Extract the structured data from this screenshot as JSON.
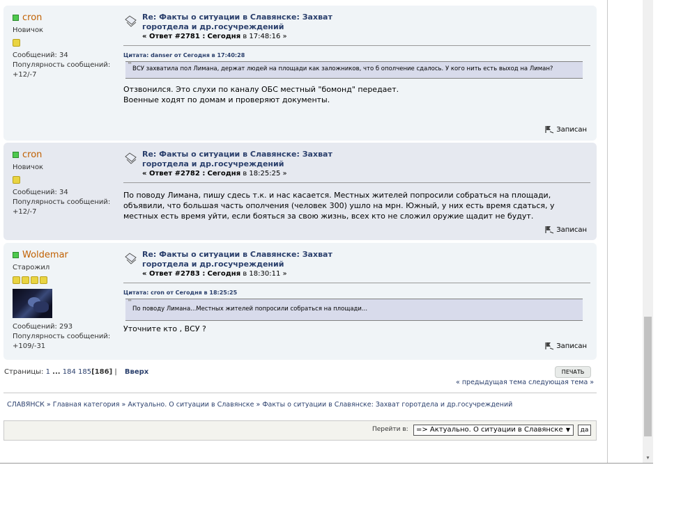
{
  "posts": [
    {
      "poster": {
        "name": "cron",
        "group": "Новичок",
        "stars": 1,
        "messages": "Сообщений: 34",
        "popularity_label": "Популярность сообщений:",
        "popularity_value": "+12/-7"
      },
      "subject_line1": "Re: Факты о ситуации в Славянске: Захват",
      "subject_line2": "горотдела и др.госучреждений",
      "reply_no": "« Ответ #2781 :",
      "reply_date": "Сегодня",
      "reply_time": " в 17:48:16 »",
      "quote_header": "Цитата: danser от Сегодня в 17:40:28",
      "quote_text": "ВСУ захватила пол Лимана, держат людей на площади как заложников, что б ополчение сдалось. У кого нить есть выход на Лиман?",
      "message": "Отзвонился. Это слухи по каналу ОБС местный \"бомонд\" передает.\nВоенные ходят по домам и проверяют документы.",
      "saved_label": "Записан"
    },
    {
      "poster": {
        "name": "cron",
        "group": "Новичок",
        "stars": 1,
        "messages": "Сообщений: 34",
        "popularity_label": "Популярность сообщений:",
        "popularity_value": "+12/-7"
      },
      "subject_line1": "Re: Факты о ситуации в Славянске: Захват",
      "subject_line2": "горотдела и др.госучреждений",
      "reply_no": "« Ответ #2782 :",
      "reply_date": "Сегодня",
      "reply_time": " в 18:25:25 »",
      "message": "По поводу Лимана, пишу сдесь т.к. и нас касается. Местных жителей попросили собраться на площади, объявили, что большая часть ополчения (человек 300) ушло на мрн. Южный, у них есть время сдаться, у местных есть время уйти, если бояться за свою жизнь, всех кто не сложил оружие щадит не будут.",
      "saved_label": "Записан"
    },
    {
      "poster": {
        "name": "Woldemar",
        "group": "Старожил",
        "stars": 4,
        "messages": "Сообщений: 293",
        "popularity_label": "Популярность сообщений:",
        "popularity_value": "+109/-31"
      },
      "subject_line1": "Re: Факты о ситуации в Славянске: Захват",
      "subject_line2": "горотдела и др.госучреждений",
      "reply_no": "« Ответ #2783 :",
      "reply_date": "Сегодня",
      "reply_time": " в 18:30:11 »",
      "quote_header": "Цитата: cron от Сегодня в 18:25:25",
      "quote_text": "По поводу Лимана...Местных жителей попросили собраться на площади...",
      "message": "Уточните кто , ВСУ ?",
      "saved_label": "Записан"
    }
  ],
  "pagination": {
    "label": "Страницы:",
    "first": "1",
    "dots": "...",
    "p184": "184",
    "p185": "185",
    "current": "[186]",
    "sep": "|",
    "top": "Вверх"
  },
  "print_label": "ПЕЧАТЬ",
  "prevnext": "« предыдущая тема следующая тема »",
  "breadcrumb": "СЛАВЯНСК » Главная категория » Актуально. О ситуации в Славянске » Факты о ситуации в Славянске: Захват горотдела и др.госучреждений",
  "jump": {
    "label": "Перейти в:",
    "selected": "=> Актуально. О ситуации в Славянске",
    "go": "да"
  },
  "colors": {
    "accent": "#2a3f6c",
    "poster_name": "#c06002",
    "quote_bg": "#d8dbeb"
  }
}
